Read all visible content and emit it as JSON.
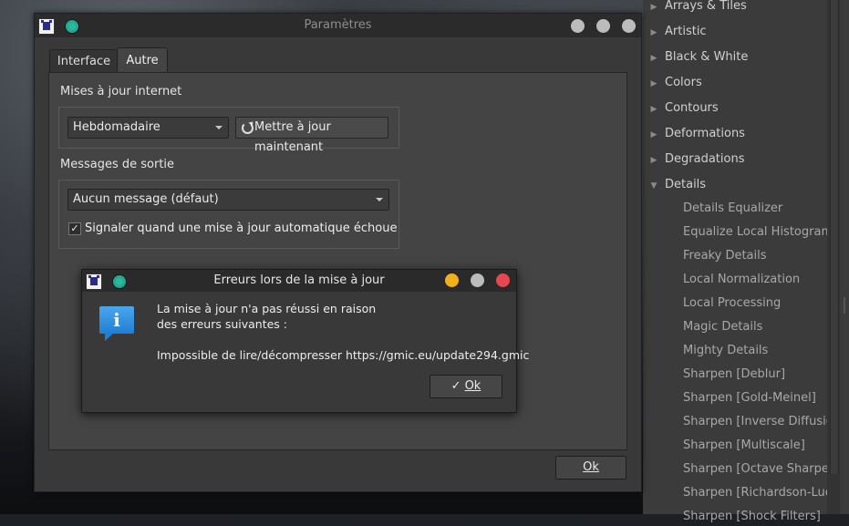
{
  "settings_dialog": {
    "title": "Paramètres",
    "tabs": [
      {
        "label": "Interface",
        "active": false
      },
      {
        "label": "Autre",
        "active": true
      }
    ],
    "updates_section": {
      "label": "Mises à jour internet",
      "frequency_value": "Hebdomadaire",
      "update_now_label": "Mettre à jour maintenant"
    },
    "output_section": {
      "label": "Messages de sortie",
      "messages_value": "Aucun message (défaut)",
      "notify_checkbox_label": "Signaler quand une mise à jour automatique échoue",
      "notify_checked": true
    },
    "ok_label": "Ok"
  },
  "error_dialog": {
    "title": "Erreurs lors de la mise à jour",
    "message_line1": "La mise à jour n'a pas réussi en raison",
    "message_line2": "des erreurs suivantes :",
    "error_detail": "Impossible de lire/décompresser https://gmic.eu/update294.gmic",
    "ok_label": "Ok"
  },
  "filters": {
    "categories": [
      {
        "label": "Arrays & Tiles",
        "expanded": false
      },
      {
        "label": "Artistic",
        "expanded": false
      },
      {
        "label": "Black & White",
        "expanded": false
      },
      {
        "label": "Colors",
        "expanded": false
      },
      {
        "label": "Contours",
        "expanded": false
      },
      {
        "label": "Deformations",
        "expanded": false
      },
      {
        "label": "Degradations",
        "expanded": false
      },
      {
        "label": "Details",
        "expanded": true
      }
    ],
    "details_items": [
      "Details Equalizer",
      "Equalize Local Histograms",
      "Freaky Details",
      "Local Normalization",
      "Local Processing",
      "Magic Details",
      "Mighty Details",
      "Sharpen [Deblur]",
      "Sharpen [Gold-Meinel]",
      "Sharpen [Inverse Diffusion]",
      "Sharpen [Multiscale]",
      "Sharpen [Octave Sharpening]",
      "Sharpen [Richardson-Lucy]",
      "Sharpen [Shock Filters]"
    ]
  },
  "colors": {
    "teal": "#2ab9a0",
    "close_red": "#e5484d",
    "minimize_yellow": "#f2b01e",
    "info_blue": "#2d8fe0"
  }
}
